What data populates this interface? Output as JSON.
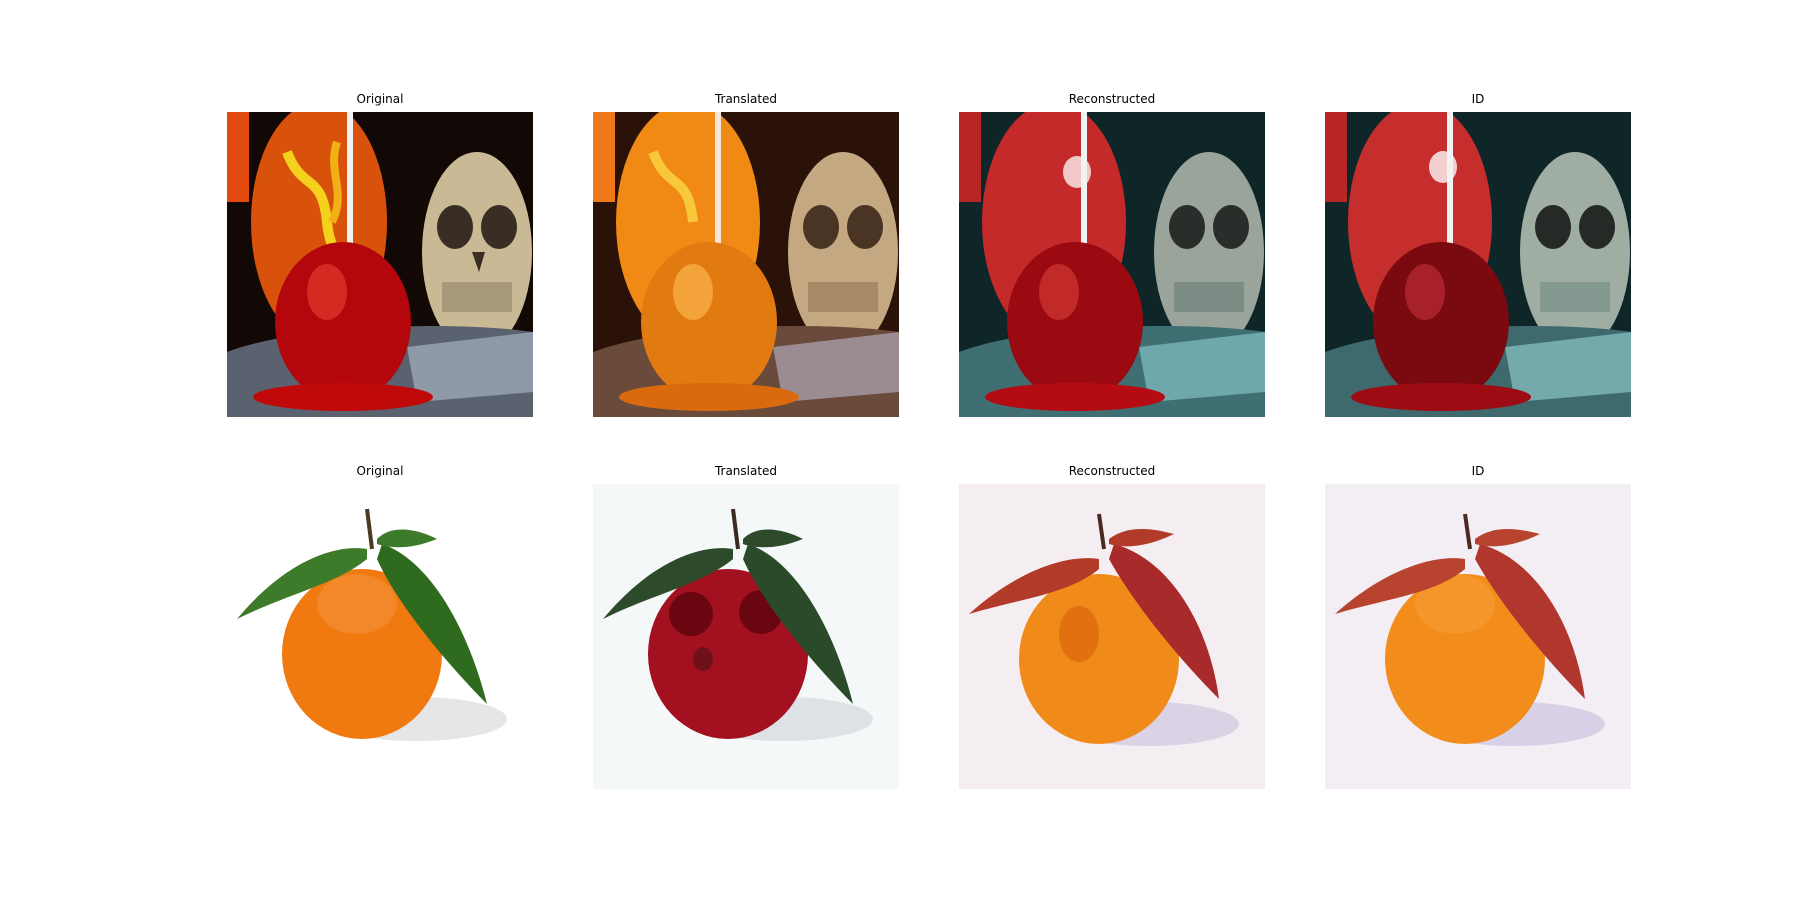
{
  "rows": [
    {
      "panels": [
        {
          "title": "Original",
          "scene": "candy-apple-original"
        },
        {
          "title": "Translated",
          "scene": "candy-apple-translated"
        },
        {
          "title": "Reconstructed",
          "scene": "candy-apple-reconstructed"
        },
        {
          "title": "ID",
          "scene": "candy-apple-id"
        }
      ]
    },
    {
      "panels": [
        {
          "title": "Original",
          "scene": "orange-original"
        },
        {
          "title": "Translated",
          "scene": "orange-translated"
        },
        {
          "title": "Reconstructed",
          "scene": "orange-reconstructed"
        },
        {
          "title": "ID",
          "scene": "orange-id"
        }
      ]
    }
  ],
  "colors": {
    "pumpkin_orange": "#e0560b",
    "apple_red": "#b3070d",
    "skull_beige": "#c9b995",
    "orange_fruit": "#f07a10",
    "leaf_green": "#2f6b1f",
    "translated_red": "#a3101f",
    "recon_teal": "#3f6f72"
  }
}
